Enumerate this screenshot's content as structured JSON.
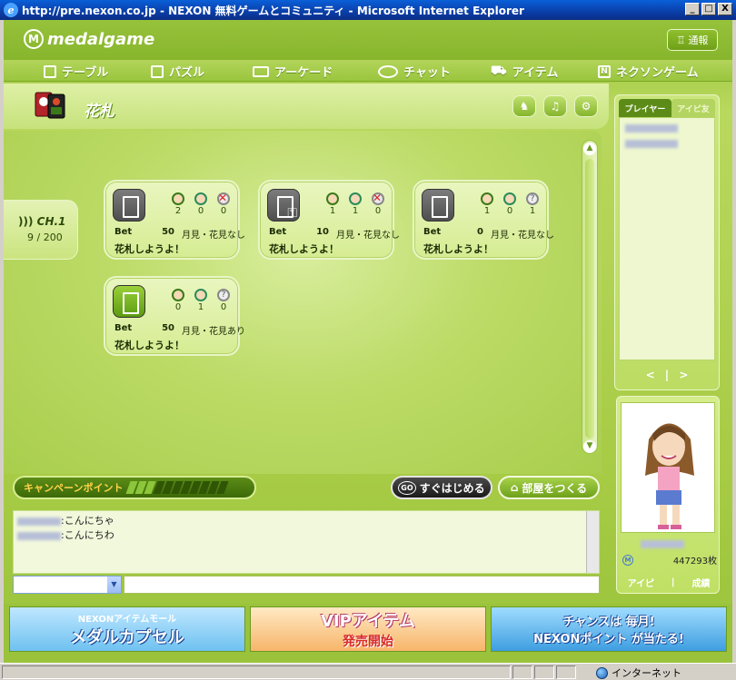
{
  "window": {
    "title": "http://pre.nexon.co.jp - NEXON 無料ゲームとコミュニティ - Microsoft Internet Explorer",
    "buttons": [
      "_",
      "□",
      "X"
    ]
  },
  "header": {
    "logo_text": "medalgame",
    "notify_label": "通報"
  },
  "menu": [
    {
      "label": "テーブル",
      "icon": "table-icon"
    },
    {
      "label": "パズル",
      "icon": "puzzle-icon"
    },
    {
      "label": "アーケード",
      "icon": "arcade-icon"
    },
    {
      "label": "チャット",
      "icon": "chat-icon"
    },
    {
      "label": "アイテム",
      "icon": "cart-icon"
    },
    {
      "label": "ネクソンゲーム",
      "icon": "nexon-icon"
    }
  ],
  "room_header": {
    "title": "花札",
    "buttons": [
      "help-icon",
      "sound-icon",
      "settings-icon"
    ]
  },
  "channel": {
    "label": "CH.1",
    "count": "9 / 200"
  },
  "rooms": [
    {
      "door": "closed",
      "seats": [
        "2",
        "0",
        "0"
      ],
      "seat_types": [
        "m",
        "f",
        "x"
      ],
      "bet_label": "Bet",
      "bet": "50",
      "condition": "月見・花見なし",
      "name": "花札しようよ！"
    },
    {
      "door": "lock",
      "seats": [
        "1",
        "1",
        "0"
      ],
      "seat_types": [
        "m",
        "f",
        "x"
      ],
      "bet_label": "Bet",
      "bet": "10",
      "condition": "月見・花見なし",
      "name": "花札しようよ！"
    },
    {
      "door": "closed",
      "seats": [
        "1",
        "0",
        "1"
      ],
      "seat_types": [
        "m",
        "f",
        "q"
      ],
      "bet_label": "Bet",
      "bet": "0",
      "condition": "月見・花見なし",
      "name": "花札しようよ！"
    },
    {
      "door": "open",
      "seats": [
        "0",
        "1",
        "0"
      ],
      "seat_types": [
        "m",
        "f",
        "q"
      ],
      "bet_label": "Bet",
      "bet": "50",
      "condition": "月見・花見あり",
      "name": "花札しようよ！"
    }
  ],
  "campaign": {
    "label": "キャンペーンポイント",
    "filled": 3,
    "total": 11
  },
  "actions": {
    "start": "すぐはじめる",
    "start_badge": "GO",
    "create": "部屋をつくる"
  },
  "chat": {
    "messages": [
      {
        "text": ":こんにちゃ"
      },
      {
        "text": ":こんにちわ"
      }
    ]
  },
  "side": {
    "tabs": [
      "プレイヤー",
      "アイピ友"
    ],
    "pager": [
      "<",
      "|",
      ">"
    ]
  },
  "profile": {
    "medals": "447293枚",
    "links": [
      "アイピ",
      "|",
      "成績"
    ]
  },
  "banners": [
    {
      "title": "NEXONアイテムモール",
      "main": "メダルカプセル"
    },
    {
      "title": "VIPアイテム",
      "main": "発売開始"
    },
    {
      "title": "チャンスは 毎月!",
      "main": "NEXONポイント が当たる!"
    }
  ],
  "status": {
    "zone": "インターネット"
  }
}
